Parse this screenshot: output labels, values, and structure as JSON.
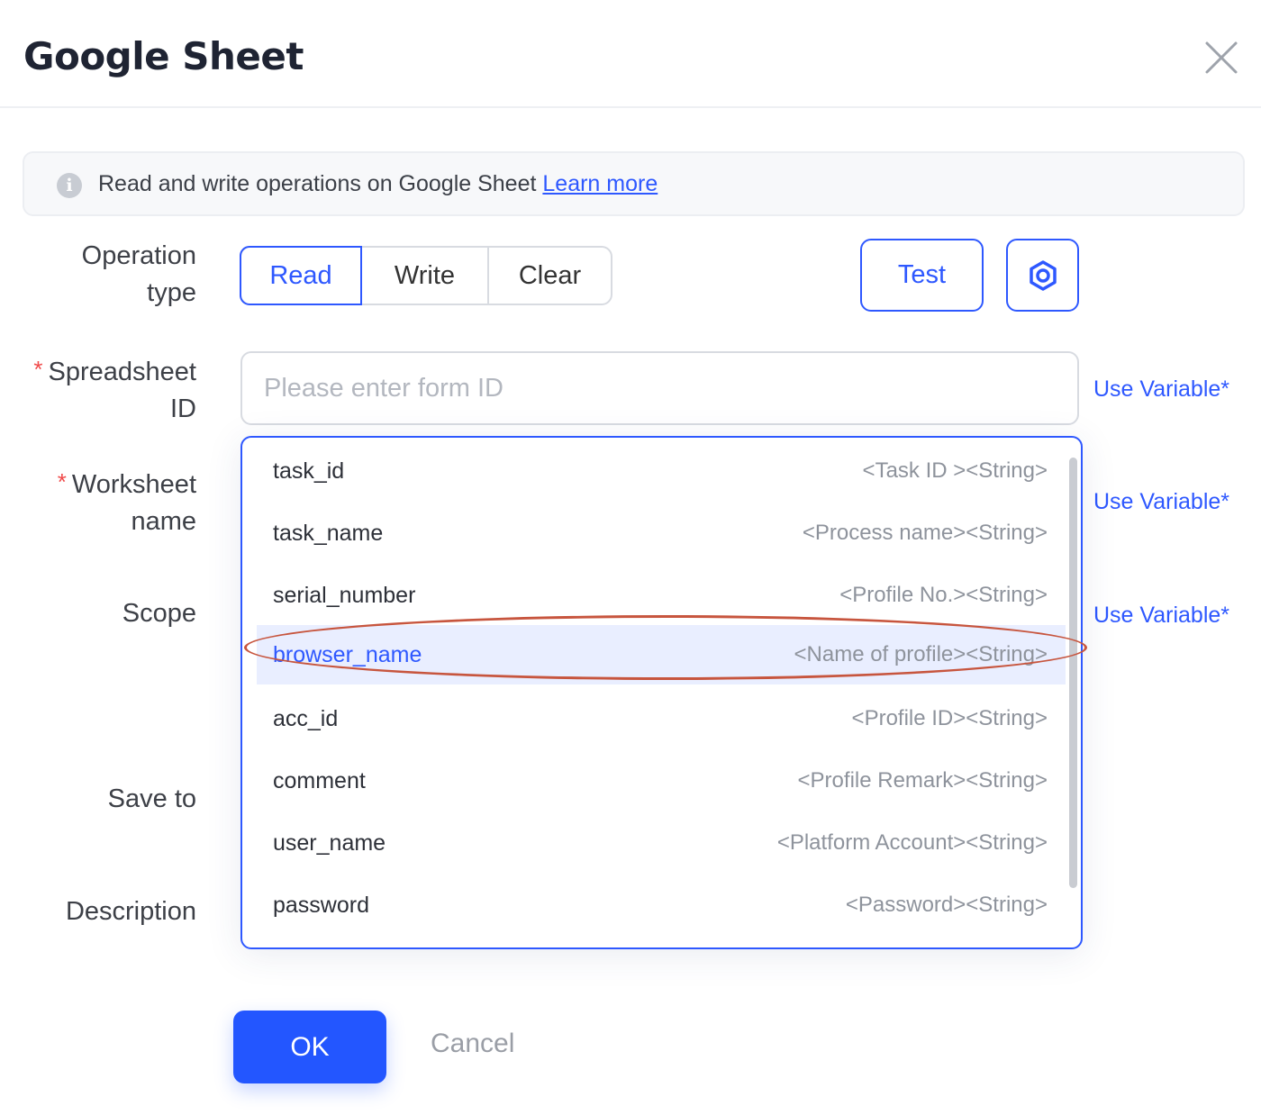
{
  "dialog": {
    "title": "Google Sheet"
  },
  "info": {
    "text": "Read and write operations on Google Sheet ",
    "link": "Learn more"
  },
  "labels": {
    "operation_type_1": "Operation",
    "operation_type_2": "type",
    "spreadsheet_1": "Spreadsheet",
    "spreadsheet_2": "ID",
    "worksheet_1": "Worksheet",
    "worksheet_2": "name",
    "scope": "Scope",
    "save_to": "Save to",
    "description": "Description",
    "required_mark": "*"
  },
  "operation": {
    "options": [
      "Read",
      "Write",
      "Clear"
    ],
    "selected": "Read"
  },
  "toolbar": {
    "test_label": "Test"
  },
  "spreadsheet_input": {
    "value": "",
    "placeholder": "Please enter form ID"
  },
  "use_variable": "Use Variable*",
  "dropdown": {
    "items": [
      {
        "name": "task_id",
        "type": "<Task ID ><String>"
      },
      {
        "name": "task_name",
        "type": "<Process name><String>"
      },
      {
        "name": "serial_number",
        "type": "<Profile No.><String>"
      },
      {
        "name": "browser_name",
        "type": "<Name of profile><String>"
      },
      {
        "name": "acc_id",
        "type": "<Profile ID><String>"
      },
      {
        "name": "comment",
        "type": "<Profile Remark><String>"
      },
      {
        "name": "user_name",
        "type": "<Platform Account><String>"
      },
      {
        "name": "password",
        "type": "<Password><String>"
      }
    ],
    "highlighted": "browser_name"
  },
  "footer": {
    "ok_label": "OK",
    "cancel_label": "Cancel"
  },
  "colors": {
    "accent": "#2e58ff",
    "required": "#f04a4a",
    "annotation": "#c7553e"
  },
  "icons": {
    "close": "close-icon",
    "info": "info-icon",
    "settings": "gear-icon"
  }
}
